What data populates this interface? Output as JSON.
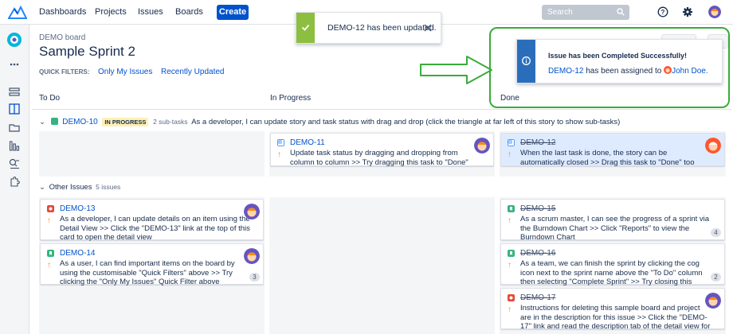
{
  "nav": {
    "dashboards": "Dashboards",
    "projects": "Projects",
    "issues": "Issues",
    "boards": "Boards",
    "create": "Create",
    "search_placeholder": "Search"
  },
  "header": {
    "board_name": "DEMO board",
    "sprint_title": "Sample Sprint 2",
    "quick_filters_label": "QUICK FILTERS:",
    "quick_filters": [
      "Only My Issues",
      "Recently Updated"
    ]
  },
  "columns": [
    "To Do",
    "In Progress",
    "Done"
  ],
  "swimlane_story": {
    "key": "DEMO-10",
    "status": "IN PROGRESS",
    "subtasks": "2 sub-tasks",
    "summary": "As a developer, I can update story and task status with drag and drop (click the triangle at far left of this story to show sub-tasks)"
  },
  "swimlane_other": {
    "label": "Other Issues",
    "count": "5 issues"
  },
  "cards": {
    "demo11": {
      "key": "DEMO-11",
      "text": [
        "Update task status by dragging and dropping from",
        "column to column >> Try dragging this task to \"Done\""
      ]
    },
    "demo12": {
      "key": "DEMO-12",
      "text": [
        "When the last task is done, the story can be",
        "automatically closed >> Drag this task to \"Done\" too"
      ]
    },
    "demo13": {
      "key": "DEMO-13",
      "text": [
        "As a developer, I can update details on an item using the",
        "Detail View >> Click the \"DEMO-13\" link at the top of this",
        "card to open the detail view"
      ]
    },
    "demo14": {
      "key": "DEMO-14",
      "text": [
        "As a user, I can find important items on the board by",
        "using the customisable \"Quick Filters\" above >> Try",
        "clicking the \"Only My Issues\" Quick Filter above"
      ],
      "count": "3"
    },
    "demo15": {
      "key": "DEMO-15",
      "text": [
        "As a scrum master, I can see the progress of a sprint via",
        "the Burndown Chart >> Click \"Reports\" to view the",
        "Burndown Chart"
      ],
      "count": "4"
    },
    "demo16": {
      "key": "DEMO-16",
      "text": [
        "As a team, we can finish the sprint by clicking the cog",
        "icon next to the sprint name above the \"To Do\" column",
        "then selecting \"Complete Sprint\" >> Try closing this"
      ],
      "count": "2"
    },
    "demo17": {
      "key": "DEMO-17",
      "text": [
        "Instructions for deleting this sample board and project",
        "are in the description for this issue >> Click the \"DEMO-",
        "17\" link and read the description tab of the detail view for"
      ]
    }
  },
  "toast_updated": {
    "text": "DEMO-12 has been updated."
  },
  "toast_completed": {
    "title": "Issue has been Completed Successfully!",
    "key": "DEMO-12",
    "middle": " has been assigned to ",
    "assignee": "John Doe."
  },
  "colors": {
    "accent": "#0052cc",
    "success": "#8cbf3f",
    "info": "#2a6ebb",
    "priority": "#ff8b00",
    "highlight": "#3aab3a"
  }
}
